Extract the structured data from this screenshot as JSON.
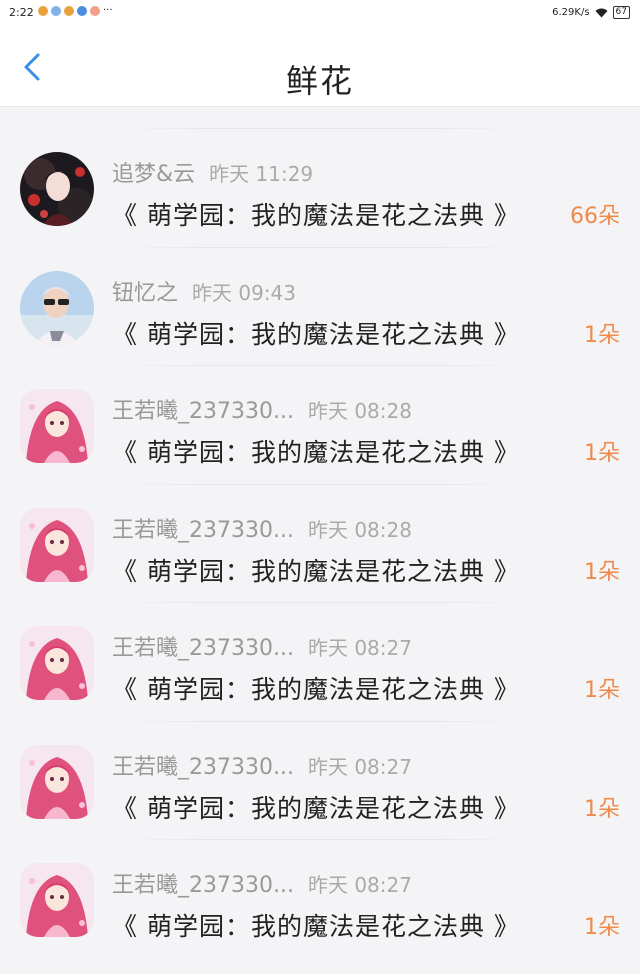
{
  "status": {
    "time": "2:22",
    "dots": "···",
    "speed": "6.29K/s",
    "battery": "67"
  },
  "page_title": "鲜花",
  "icons": {
    "back": "chevron-left-icon",
    "wifi": "wifi-icon"
  },
  "colors": {
    "accent_blue": "#3a8ee6",
    "count_orange": "#f08a4b"
  },
  "entries": [
    {
      "user": "追梦&云",
      "time": "昨天 11:29",
      "book": "《 萌学园：我的魔法是花之法典 》",
      "count": "66朵"
    },
    {
      "user": "钮忆之",
      "time": "昨天 09:43",
      "book": "《 萌学园：我的魔法是花之法典 》",
      "count": "1朵"
    },
    {
      "user": "王若曦_237330...",
      "time": "昨天 08:28",
      "book": "《 萌学园：我的魔法是花之法典 》",
      "count": "1朵"
    },
    {
      "user": "王若曦_237330...",
      "time": "昨天 08:28",
      "book": "《 萌学园：我的魔法是花之法典 》",
      "count": "1朵"
    },
    {
      "user": "王若曦_237330...",
      "time": "昨天 08:27",
      "book": "《 萌学园：我的魔法是花之法典 》",
      "count": "1朵"
    },
    {
      "user": "王若曦_237330...",
      "time": "昨天 08:27",
      "book": "《 萌学园：我的魔法是花之法典 》",
      "count": "1朵"
    },
    {
      "user": "王若曦_237330...",
      "time": "昨天 08:27",
      "book": "《 萌学园：我的魔法是花之法典 》",
      "count": "1朵"
    }
  ]
}
